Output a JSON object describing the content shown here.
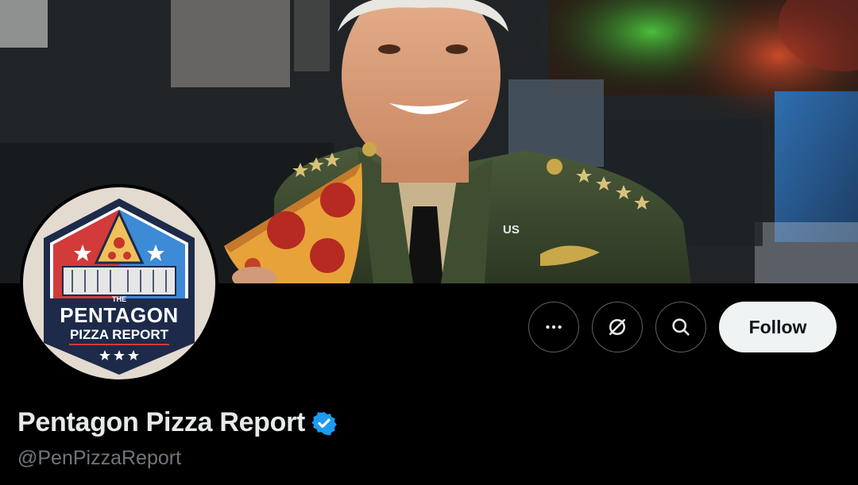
{
  "profile": {
    "display_name": "Pentagon Pizza Report",
    "handle": "@PenPizzaReport",
    "verified": true
  },
  "banner": {
    "insignia_text": "US"
  },
  "avatar": {
    "logo_the": "THE",
    "logo_line1": "PENTAGON",
    "logo_line2": "PIZZA REPORT"
  },
  "actions": {
    "more_icon": "more-horizontal-icon",
    "grok_icon": "grok-icon",
    "search_icon": "search-icon",
    "follow_label": "Follow"
  },
  "colors": {
    "background": "#000000",
    "follow_bg": "#eff3f4",
    "verified_blue": "#1d9bf0",
    "handle_gray": "#71767b"
  }
}
